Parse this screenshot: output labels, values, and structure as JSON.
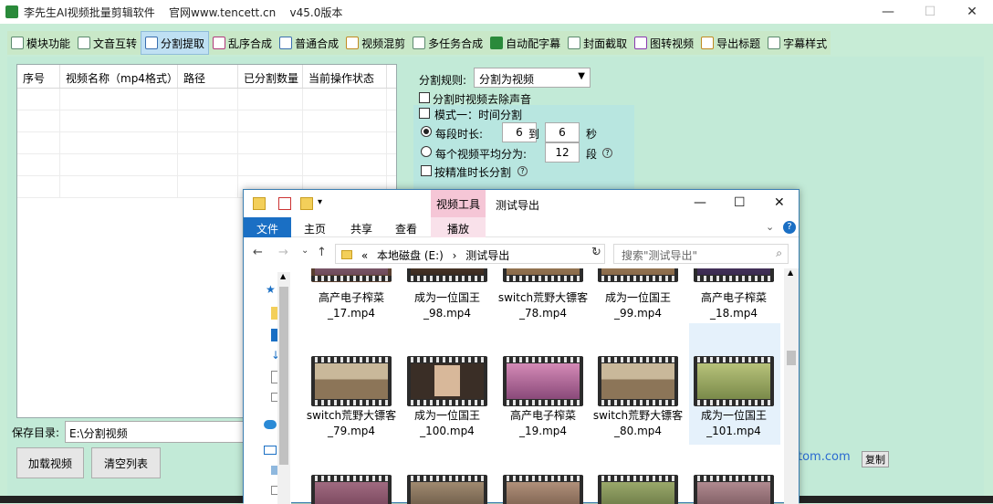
{
  "app": {
    "title": "李先生AI视频批量剪辑软件    官网www.tencett.cn    v45.0版本"
  },
  "window_controls": {
    "minimize": "—",
    "maximize": "☐",
    "close": "✕"
  },
  "tabs": [
    {
      "label": "模块功能",
      "icon": "grid-icon"
    },
    {
      "label": "文音互转",
      "icon": "audio-icon"
    },
    {
      "label": "分割提取",
      "icon": "split-icon"
    },
    {
      "label": "乱序合成",
      "icon": "shuffle-icon"
    },
    {
      "label": "普通合成",
      "icon": "layers-icon"
    },
    {
      "label": "视频混剪",
      "icon": "film-icon"
    },
    {
      "label": "多任务合成",
      "icon": "tasks-icon"
    },
    {
      "label": "自动配字幕",
      "icon": "subtitle-icon"
    },
    {
      "label": "封面截取",
      "icon": "image-icon"
    },
    {
      "label": "图转视频",
      "icon": "photo-video-icon"
    },
    {
      "label": "导出标题",
      "icon": "export-icon"
    },
    {
      "label": "字幕样式",
      "icon": "text-icon"
    }
  ],
  "active_tab": "分割提取",
  "table": {
    "headers": [
      "序号",
      "视频名称（mp4格式）",
      "路径",
      "已分割数量",
      "当前操作状态"
    ]
  },
  "save": {
    "label": "保存目录:",
    "value": "E:\\分割视频"
  },
  "buttons": {
    "load": "加载视频",
    "clear": "清空列表",
    "copy": "复制"
  },
  "footer_link": "tom.com",
  "settings": {
    "split_rule_label": "分割规则:",
    "split_rule_value": "分割为视频",
    "remove_audio": "分割时视频去除声音",
    "mode_one": "模式一：时间分割",
    "per_segment_label": "每段时长:",
    "per_segment_from": "6",
    "to_label": "到",
    "per_segment_to": "6",
    "seconds": "秒",
    "average_label": "每个视频平均分为:",
    "average_value": "12",
    "segments": "段",
    "precise": "按精准时长分割"
  },
  "explorer": {
    "context_tab_header": "视频工具",
    "window_title": "测试导出",
    "ribbon_tabs": [
      "文件",
      "主页",
      "共享",
      "查看",
      "播放"
    ],
    "address": {
      "prefix": "«",
      "drive": "本地磁盘 (E:)",
      "sep": "›",
      "folder": "测试导出"
    },
    "search_placeholder": "搜索\"测试导出\"",
    "files_row1": [
      {
        "name": "高产电子榨菜_17.mp4"
      },
      {
        "name": "成为一位国王_98.mp4"
      },
      {
        "name": "switch荒野大镖客_78.mp4"
      },
      {
        "name": "成为一位国王_99.mp4"
      },
      {
        "name": "高产电子榨菜_18.mp4"
      }
    ],
    "files_row2": [
      {
        "name": "switch荒野大镖客_79.mp4"
      },
      {
        "name": "成为一位国王_100.mp4"
      },
      {
        "name": "高产电子榨菜_19.mp4"
      },
      {
        "name": "switch荒野大镖客_80.mp4"
      },
      {
        "name": "成为一位国王_101.mp4",
        "selected": true
      }
    ]
  }
}
